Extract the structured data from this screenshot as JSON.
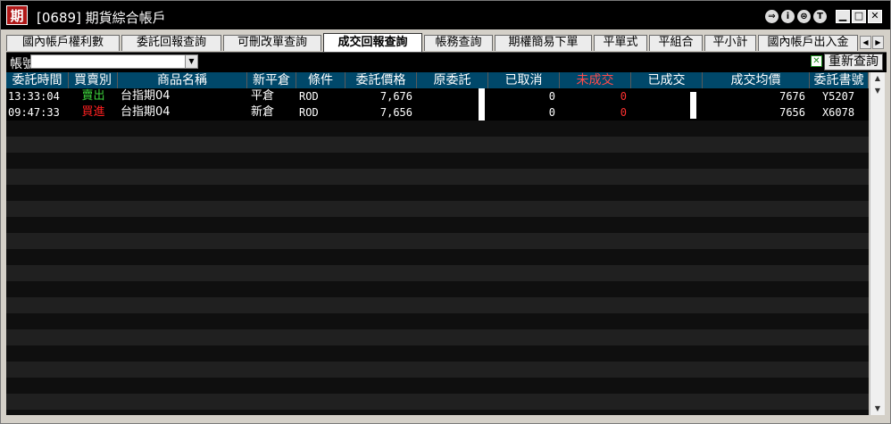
{
  "window": {
    "title": "[0689] 期貨綜合帳戶",
    "logo_text": "期",
    "toolbar_icons": [
      "arrow-icon",
      "info-icon",
      "print-icon",
      "t-icon"
    ],
    "controls": {
      "minimize": "▁",
      "maximize": "□",
      "close": "✕"
    }
  },
  "tabs": [
    {
      "label": "國內帳戶權利數"
    },
    {
      "label": "委託回報查詢"
    },
    {
      "label": "可刪改單查詢"
    },
    {
      "label": "成交回報查詢",
      "active": true
    },
    {
      "label": "帳務查詢"
    },
    {
      "label": "期權簡易下單"
    },
    {
      "label": "平單式"
    },
    {
      "label": "平組合"
    },
    {
      "label": "平小計"
    },
    {
      "label": "國內帳戶出入金"
    }
  ],
  "toolbar": {
    "account_label": "帳號",
    "refresh_label": "重新查詢"
  },
  "grid": {
    "columns": [
      "委託時間",
      "買賣別",
      "商品名稱",
      "新平倉",
      "條件",
      "委託價格",
      "原委託",
      "已取消",
      "未成交",
      "已成交",
      "成交均價",
      "委託書號"
    ],
    "rows": [
      {
        "time": "13:33:04",
        "side": "賣出",
        "product": "台指期04",
        "open_close": "平倉",
        "condition": "ROD",
        "price": "7,676",
        "original": "",
        "cancelled": "0",
        "unfilled": "0",
        "filled": "",
        "avg_price": "7676",
        "order_no": "Y5207"
      },
      {
        "time": "09:47:33",
        "side": "買進",
        "product": "台指期04",
        "open_close": "新倉",
        "condition": "ROD",
        "price": "7,656",
        "original": "",
        "cancelled": "0",
        "unfilled": "0",
        "filled": "",
        "avg_price": "7656",
        "order_no": "X6078"
      }
    ]
  },
  "colors": {
    "header_bg": "#00486a",
    "header_text": "#ffffff",
    "header_unfilled": "#ff4a4a",
    "sell": "#3cd23c",
    "buy": "#ff2020",
    "unfilled_value": "#ff3030"
  }
}
